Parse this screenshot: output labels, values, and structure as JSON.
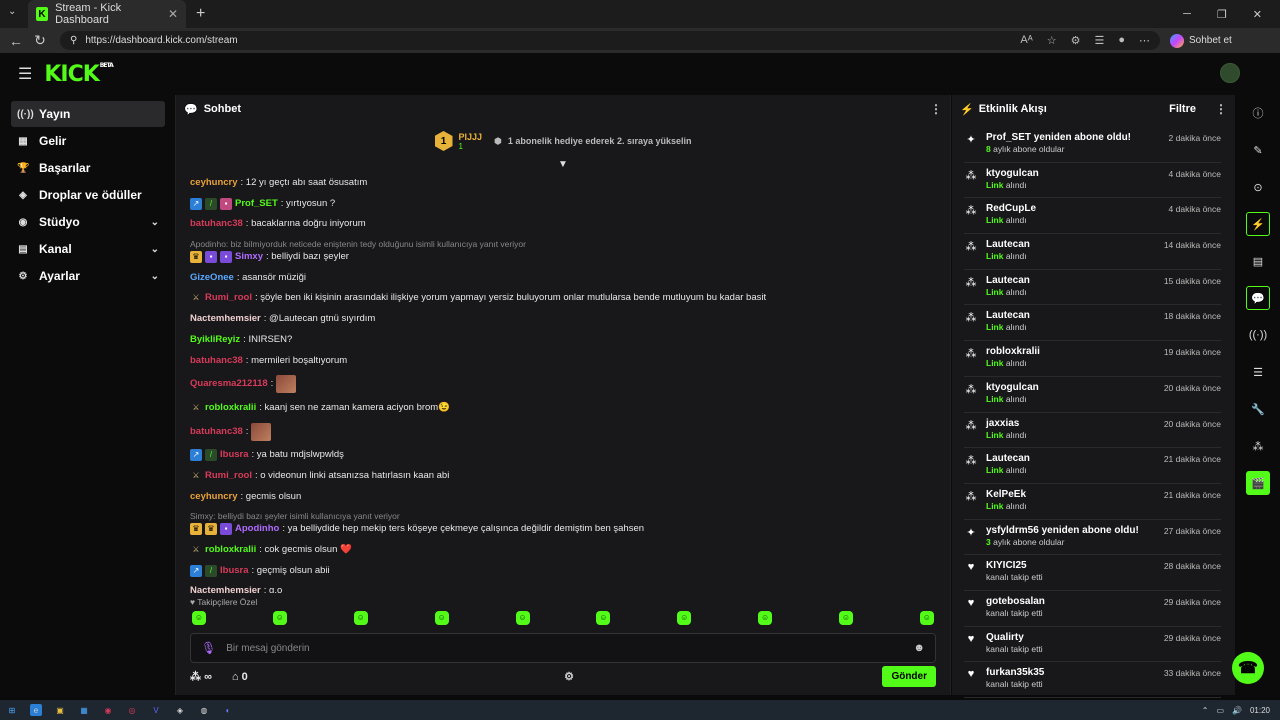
{
  "browser": {
    "tab_title": "Stream - Kick Dashboard",
    "url": "https://dashboard.kick.com/stream",
    "copilot_label": "Sohbet et"
  },
  "brand": {
    "logo": "KICK",
    "beta": "BETA",
    "accent": "#53fc18"
  },
  "sidebar": {
    "items": [
      {
        "label": "Yayın",
        "icon": "broadcast-icon",
        "active": true
      },
      {
        "label": "Gelir",
        "icon": "wallet-icon"
      },
      {
        "label": "Başarılar",
        "icon": "trophy-icon"
      },
      {
        "label": "Droplar ve ödüller",
        "icon": "gift-icon"
      },
      {
        "label": "Stüdyo",
        "icon": "studio-icon",
        "expandable": true
      },
      {
        "label": "Kanal",
        "icon": "channel-icon",
        "expandable": true
      },
      {
        "label": "Ayarlar",
        "icon": "gear-icon",
        "expandable": true
      }
    ]
  },
  "chat": {
    "title": "Sohbet",
    "pinned": {
      "rank": "1",
      "user": "PIJJJ",
      "subs": "1",
      "text": "1 abonelik hediye ederek 2. sıraya yükselin"
    },
    "messages": [
      {
        "user": "ceyhuncry",
        "color": "#e8a23a",
        "text": ": 12 yı geçtı abı saat ösusatım"
      },
      {
        "user": "Prof_SET",
        "color": "#53fc18",
        "text": ": yırtıyosun ?",
        "badges": [
          "b-blue",
          "b-grn",
          "b-pink"
        ]
      },
      {
        "user": "batuhanc38",
        "color": "#d83a5a",
        "text": ": bacaklarına doğru iniyorum"
      },
      {
        "reply": "Apodinho: biz bilmiyorduk neticede eniştenin tedy olduğunu isimli kullanıcıya yanıt veriyor",
        "user": "Simxy",
        "color": "#b06cff",
        "text": ": belliydi bazı şeyler",
        "badges": [
          "b-gold",
          "b-pur",
          "b-pur"
        ]
      },
      {
        "user": "GizeOnee",
        "color": "#5aa8ff",
        "text": ": asansör müziği"
      },
      {
        "user": "Rumi_rool",
        "color": "#d83a5a",
        "text": ": şöyle ben iki kişinin arasındaki ilişkiye yorum yapmayı yersiz buluyorum onlar mutlularsa bende mutluyum bu kadar basit",
        "badges": [
          "b-sw"
        ]
      },
      {
        "user": "Nactemhemsier",
        "color": "#f0d0d0",
        "text": ": @Lautecan gtnü sıyırdım"
      },
      {
        "user": "ByikliReyiz",
        "color": "#53fc18",
        "text": ": INIRSEN?"
      },
      {
        "user": "batuhanc38",
        "color": "#d83a5a",
        "text": ": mermileri boşaltıyorum"
      },
      {
        "user": "Quaresma212118",
        "color": "#d83a5a",
        "text": ":",
        "emote": true
      },
      {
        "user": "robloxkralii",
        "color": "#53fc18",
        "text": ": kaanj sen ne zaman kamera aciyon brom😉",
        "badges": [
          "b-sw"
        ]
      },
      {
        "user": "batuhanc38",
        "color": "#d83a5a",
        "text": ":",
        "emote": true
      },
      {
        "user": "Ibusra",
        "color": "#d83a5a",
        "text": ": ya batu mdjslwpwldş",
        "badges": [
          "b-blue",
          "b-grn"
        ]
      },
      {
        "user": "Rumi_rool",
        "color": "#d83a5a",
        "text": ": o videonun linki atsanızsa hatırlasın kaan abi",
        "badges": [
          "b-sw"
        ]
      },
      {
        "user": "ceyhuncry",
        "color": "#e8a23a",
        "text": ": gecmis olsun"
      },
      {
        "reply": "Simxy: belliydi bazı şeyler isimli kullanıcıya yanıt veriyor",
        "user": "Apodinho",
        "color": "#b06cff",
        "text": ": ya belliydide hep mekip ters köşeye çekmeye çalışınca değildir demiştim ben şahsen",
        "badges": [
          "b-gold",
          "b-gold",
          "b-pur"
        ]
      },
      {
        "user": "robloxkralii",
        "color": "#53fc18",
        "text": ": cok gecmis olsun ❤️",
        "badges": [
          "b-sw"
        ]
      },
      {
        "user": "Ibusra",
        "color": "#d83a5a",
        "text": ": geçmiş olsun abii",
        "badges": [
          "b-blue",
          "b-grn"
        ]
      },
      {
        "user": "Nactemhemsier",
        "color": "#f0d0d0",
        "text": ": g.o"
      }
    ],
    "followers_label": "Takipçilere Özel",
    "input_placeholder": "Bir mesaj gönderin",
    "viewers": "∞",
    "gifts": "0",
    "send_label": "Gönder"
  },
  "activity": {
    "title": "Etkinlik Akışı",
    "filter_label": "Filtre",
    "items": [
      {
        "type": "sub",
        "name": "Prof_SET yeniden abone oldu!",
        "hl": "8",
        "rest": " aylık abone oldular",
        "time": "2 dakika önce"
      },
      {
        "type": "link",
        "name": "ktyogulcan",
        "hl": "Link",
        "rest": " alındı",
        "time": "4 dakika önce"
      },
      {
        "type": "link",
        "name": "RedCupLe",
        "hl": "Link",
        "rest": " alındı",
        "time": "4 dakika önce"
      },
      {
        "type": "link",
        "name": "Lautecan",
        "hl": "Link",
        "rest": " alındı",
        "time": "14 dakika önce"
      },
      {
        "type": "link",
        "name": "Lautecan",
        "hl": "Link",
        "rest": " alındı",
        "time": "15 dakika önce"
      },
      {
        "type": "link",
        "name": "Lautecan",
        "hl": "Link",
        "rest": " alındı",
        "time": "18 dakika önce"
      },
      {
        "type": "link",
        "name": "robloxkralii",
        "hl": "Link",
        "rest": " alındı",
        "time": "19 dakika önce"
      },
      {
        "type": "link",
        "name": "ktyogulcan",
        "hl": "Link",
        "rest": " alındı",
        "time": "20 dakika önce"
      },
      {
        "type": "link",
        "name": "jaxxias",
        "hl": "Link",
        "rest": " alındı",
        "time": "20 dakika önce"
      },
      {
        "type": "link",
        "name": "Lautecan",
        "hl": "Link",
        "rest": " alındı",
        "time": "21 dakika önce"
      },
      {
        "type": "link",
        "name": "KelPeEk",
        "hl": "Link",
        "rest": " alındı",
        "time": "21 dakika önce"
      },
      {
        "type": "sub",
        "name": "ysfyldrm56 yeniden abone oldu!",
        "hl": "3",
        "rest": " aylık abone oldular",
        "time": "27 dakika önce"
      },
      {
        "type": "follow",
        "name": "KIYICI25",
        "hl": "",
        "rest": "kanalı takip etti",
        "time": "28 dakika önce"
      },
      {
        "type": "follow",
        "name": "gotebosalan",
        "hl": "",
        "rest": "kanalı takip etti",
        "time": "29 dakika önce"
      },
      {
        "type": "follow",
        "name": "Qualirty",
        "hl": "",
        "rest": "kanalı takip etti",
        "time": "29 dakika önce"
      },
      {
        "type": "follow",
        "name": "furkan35k35",
        "hl": "",
        "rest": "kanalı takip etti",
        "time": "33 dakika önce"
      }
    ]
  },
  "taskbar": {
    "time": "01:20"
  }
}
